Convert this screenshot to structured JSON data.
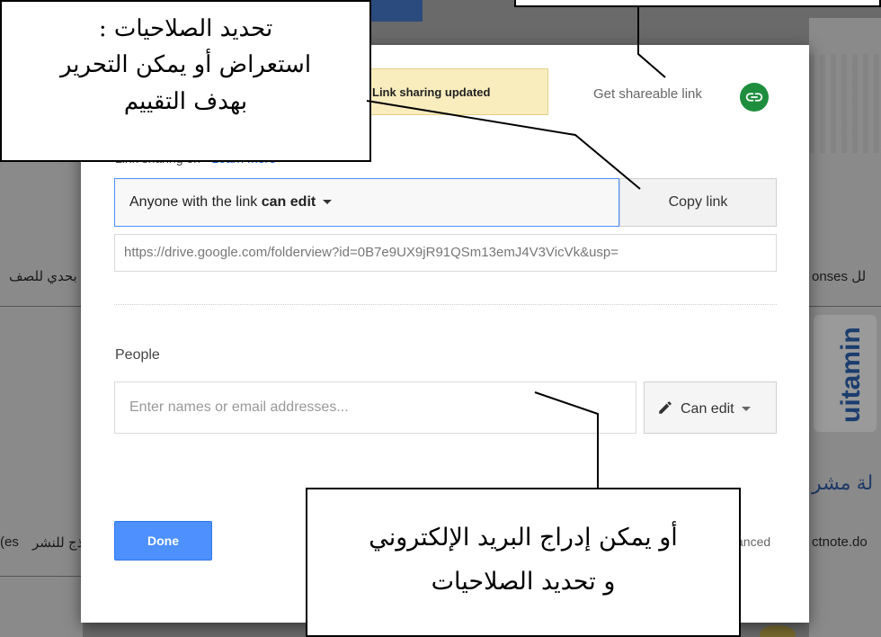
{
  "background": {
    "left_text": "بحدي للصف",
    "left_text_lower": "(es",
    "left_text_lower2": "ذج للنشر",
    "right_text": "onses لل",
    "right_arabic": "لة مشر",
    "right_domain": "ctnote.do"
  },
  "dialog": {
    "toast": "Link sharing updated",
    "get_shareable_link": "Get shareable link",
    "sharing_label": "Link sharing on",
    "learn_more": "Learn more",
    "access_prefix": "Anyone with the link ",
    "access_level": "can edit",
    "copy_link": "Copy link",
    "url": "https://drive.google.com/folderview?id=0B7e9UX9jR91QSm13emJ4V3VicVk&usp=",
    "people_label": "People",
    "people_placeholder": "Enter names or email addresses...",
    "permission": "Can edit",
    "done": "Done",
    "advanced": "anced"
  },
  "annotations": {
    "left_line1": "تحديد الصلاحيات :",
    "left_line2": "استعراض أو يمكن التحرير",
    "left_line3": "بهدف التقييم",
    "bottom_line1": "أو يمكن إدراج البريد الإلكتروني",
    "bottom_line2": "و تحديد الصلاحيات"
  },
  "colors": {
    "done_button": "#4d90fe",
    "link_icon": "#1e8e3e",
    "toast_bg": "#f9edbe"
  },
  "icons": [
    "link-icon",
    "pencil-icon",
    "dropdown-caret-icon"
  ]
}
